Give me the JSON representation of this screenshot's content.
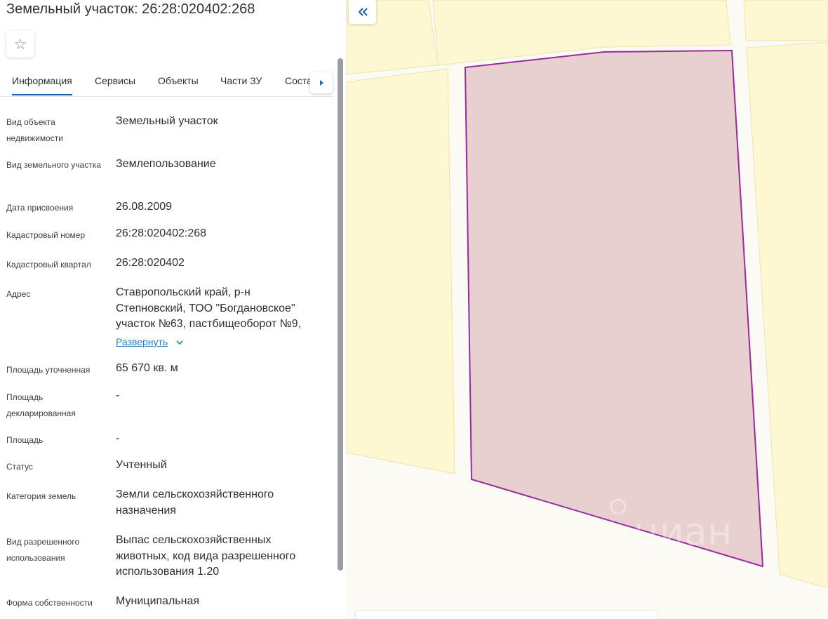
{
  "page": {
    "title": "Земельный участок: 26:28:020402:268"
  },
  "favorite": {
    "icon": "star-outline-icon",
    "glyph": "☆"
  },
  "tabs": [
    {
      "label": "Информация",
      "active": true
    },
    {
      "label": "Сервисы"
    },
    {
      "label": "Объекты"
    },
    {
      "label": "Части ЗУ"
    },
    {
      "label": "Состав"
    }
  ],
  "fields": [
    {
      "label": "Вид объекта недвижимости",
      "value": "Земельный участок"
    },
    {
      "label": "Вид земельного участка",
      "value": "Землепользование"
    },
    {
      "label": "Дата присвоения",
      "value": "26.08.2009"
    },
    {
      "label": "Кадастровый номер",
      "value": "26:28:020402:268"
    },
    {
      "label": "Кадастровый квартал",
      "value": "26:28:020402"
    },
    {
      "label": "Адрес",
      "value": "Ставропольский край, р-н Степновский, ТОО \"Богдановское\" участок №63, пастбищеоборот №9,"
    },
    {
      "label": "Площадь уточненная",
      "value": "65 670 кв. м"
    },
    {
      "label": "Площадь декларированная",
      "value": "-"
    },
    {
      "label": "Площадь",
      "value": "-"
    },
    {
      "label": "Статус",
      "value": "Учтенный"
    },
    {
      "label": "Категория земель",
      "value": "Земли сельскохозяйственного назначения"
    },
    {
      "label": "Вид разрешенного использования",
      "value": "Выпас сельскохозяйственных животных, код вида разрешенного использования 1.20"
    },
    {
      "label": "Форма собственности",
      "value": "Муниципальная"
    }
  ],
  "address_expand": {
    "label": "Развернуть",
    "icon": "chevron-down-icon"
  },
  "map": {
    "collapse_icon": "double-chevron-left-icon",
    "colors": {
      "background": "#fbfaf5",
      "parcel_fill": "#fdf8d2",
      "parcel_stroke": "#ece5a8",
      "selected_fill": "#e8d0d0",
      "selected_stroke": "#9b2a9b",
      "accent": "#1a5fa8"
    },
    "watermark": "циан"
  }
}
